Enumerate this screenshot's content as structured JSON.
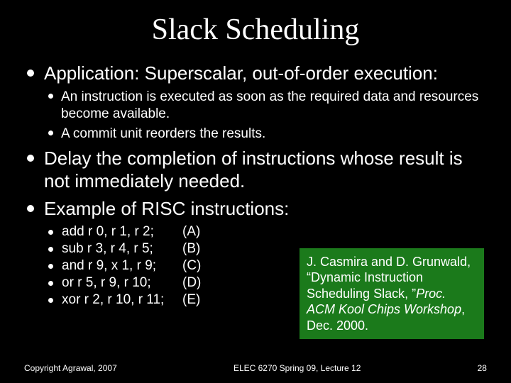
{
  "title": "Slack Scheduling",
  "bullets": {
    "b1": "Application: Superscalar, out-of-order execution:",
    "b1_sub1": "An instruction is executed as soon as the required data and resources become available.",
    "b1_sub2": "A commit unit reorders the results.",
    "b2": "Delay the completion of instructions whose result is not immediately needed.",
    "b3": "Example of RISC instructions:"
  },
  "code": [
    {
      "instr": "add  r 0, r 1, r 2;",
      "lbl": "(A)"
    },
    {
      "instr": "sub r 3, r 4, r 5;",
      "lbl": "(B)"
    },
    {
      "instr": "and r 9, x 1, r 9;",
      "lbl": "(C)"
    },
    {
      "instr": "or   r 5, r 9, r 10;",
      "lbl": "(D)"
    },
    {
      "instr": "xor r 2, r 10, r 11;",
      "lbl": "(E)"
    }
  ],
  "reference": {
    "authors": "J. Casmira and D. Grunwald, ",
    "title_quoted": "“Dynamic Instruction Scheduling Slack, ”",
    "venue": "Proc. ACM Kool Chips Workshop",
    "date": ", Dec. 2000."
  },
  "footer": {
    "left": "Copyright Agrawal, 2007",
    "center": "ELEC 6270 Spring 09, Lecture 12",
    "right": "28"
  }
}
